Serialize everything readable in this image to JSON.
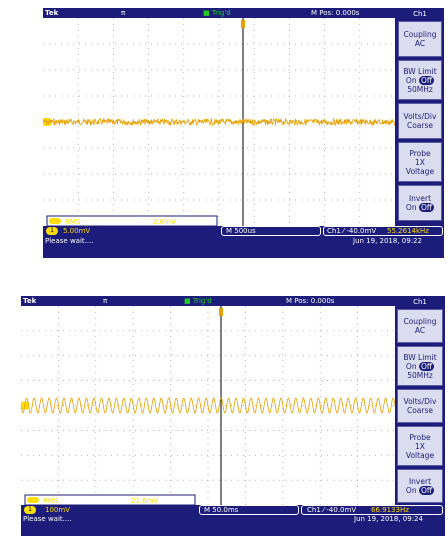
{
  "colors": {
    "frame": "#1c1c7a",
    "trace": "#e8a000",
    "trigger_indicator": "#22cc22",
    "channel": "#ffdd00"
  },
  "screens": [
    {
      "top": {
        "brand": "Tek",
        "run_icon": "π",
        "trigger_status": "Trig'd",
        "position": "M Pos: 0.000s"
      },
      "menu": {
        "title": "Ch1",
        "buttons": [
          {
            "line1": "Coupling",
            "line2": "AC"
          },
          {
            "line1": "BW Limit",
            "on": "On",
            "off": "Off",
            "line3": "50MHz"
          },
          {
            "line1": "Volts/Div",
            "line2": "Coarse"
          },
          {
            "line1": "Probe",
            "line2": "1X",
            "line3": "Voltage"
          },
          {
            "line1": "Invert",
            "on": "On",
            "off": "Off"
          }
        ]
      },
      "measure": {
        "label": "RMS",
        "value": "2.0mV"
      },
      "status": {
        "channel": "1",
        "volts_div": "5.00mV",
        "timebase": "M 500us",
        "trigger": "Ch1 ⁄ -40.0mV",
        "frequency": "55.2614kHz"
      },
      "message": "Please wait....",
      "datetime": "Jun 19, 2018, 09:22",
      "chart_data": {
        "type": "line",
        "waveform": "noise",
        "amplitude_div": 0.12,
        "cycles": 0
      }
    },
    {
      "top": {
        "brand": "Tek",
        "run_icon": "π",
        "trigger_status": "Trig'd",
        "position": "M Pos: 0.000s"
      },
      "menu": {
        "title": "Ch1",
        "buttons": [
          {
            "line1": "Coupling",
            "line2": "AC"
          },
          {
            "line1": "BW Limit",
            "on": "On",
            "off": "Off",
            "line3": "50MHz"
          },
          {
            "line1": "Volts/Div",
            "line2": "Coarse"
          },
          {
            "line1": "Probe",
            "line2": "1X",
            "line3": "Voltage"
          },
          {
            "line1": "Invert",
            "on": "On",
            "off": "Off"
          }
        ]
      },
      "measure": {
        "label": "RMS",
        "value": "21.6mV"
      },
      "status": {
        "channel": "1",
        "volts_div": "100mV",
        "timebase": "M 50.0ms",
        "trigger": "Ch1 ⁄ -40.0mV",
        "frequency": "66.9133Hz"
      },
      "message": "Please wait....",
      "datetime": "Jun 19, 2018, 09:24",
      "chart_data": {
        "type": "line",
        "waveform": "sine",
        "amplitude_div": 0.3,
        "cycles": 50
      }
    }
  ]
}
